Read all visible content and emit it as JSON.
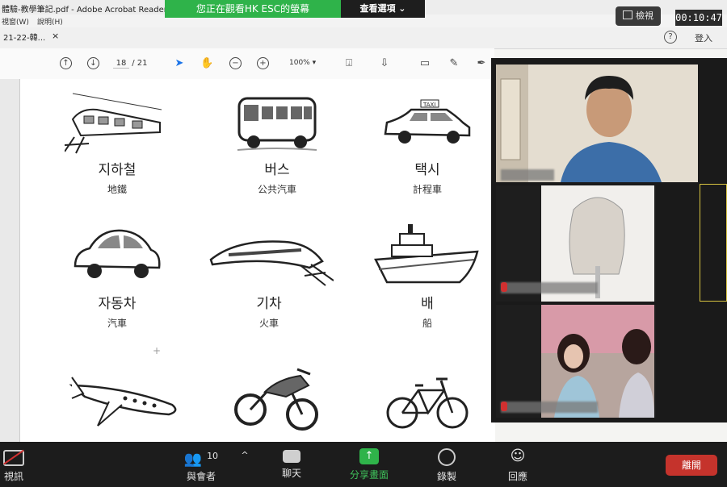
{
  "window": {
    "title": "體驗-教學筆記.pdf - Adobe Acrobat Reader DC"
  },
  "menu": {
    "items": [
      "視窗(W)",
      "說明(H)"
    ]
  },
  "tab": {
    "label": "21-22-韓...",
    "close": "×"
  },
  "share_banner": {
    "text": "您正在觀看HK ESC的螢幕",
    "options": "查看選項 ⌄"
  },
  "top_right": {
    "view_button": "檢視",
    "clock": "00:10:47",
    "help": "?",
    "login": "登入"
  },
  "pdf_toolbar": {
    "page_current": "18",
    "page_total": "/ 21",
    "zoom": "100%"
  },
  "vocab": [
    {
      "ko": "지하철",
      "zh": "地鐵",
      "icon": "subway-train"
    },
    {
      "ko": "버스",
      "zh": "公共汽車",
      "icon": "bus"
    },
    {
      "ko": "택시",
      "zh": "計程車",
      "icon": "taxi"
    },
    {
      "ko": "자동차",
      "zh": "汽車",
      "icon": "car"
    },
    {
      "ko": "기차",
      "zh": "火車",
      "icon": "train"
    },
    {
      "ko": "배",
      "zh": "船",
      "icon": "ship"
    },
    {
      "ko": "",
      "zh": "",
      "icon": "airplane"
    },
    {
      "ko": "",
      "zh": "",
      "icon": "motorcycle"
    },
    {
      "ko": "",
      "zh": "",
      "icon": "bicycle"
    }
  ],
  "participants": [
    {
      "name": "",
      "muted": true
    },
    {
      "name": "",
      "muted": true
    },
    {
      "name": "",
      "muted": true
    }
  ],
  "bottom_bar": {
    "stop_video": "視訊",
    "participants_label": "與會者",
    "participants_count": "10",
    "chat": "聊天",
    "share": "分享畫面",
    "record": "錄製",
    "reactions": "回應",
    "leave": "離開"
  },
  "colors": {
    "share_green": "#2fb34a",
    "leave_red": "#c5332c",
    "toolbar_dark": "#1c1c1c"
  }
}
